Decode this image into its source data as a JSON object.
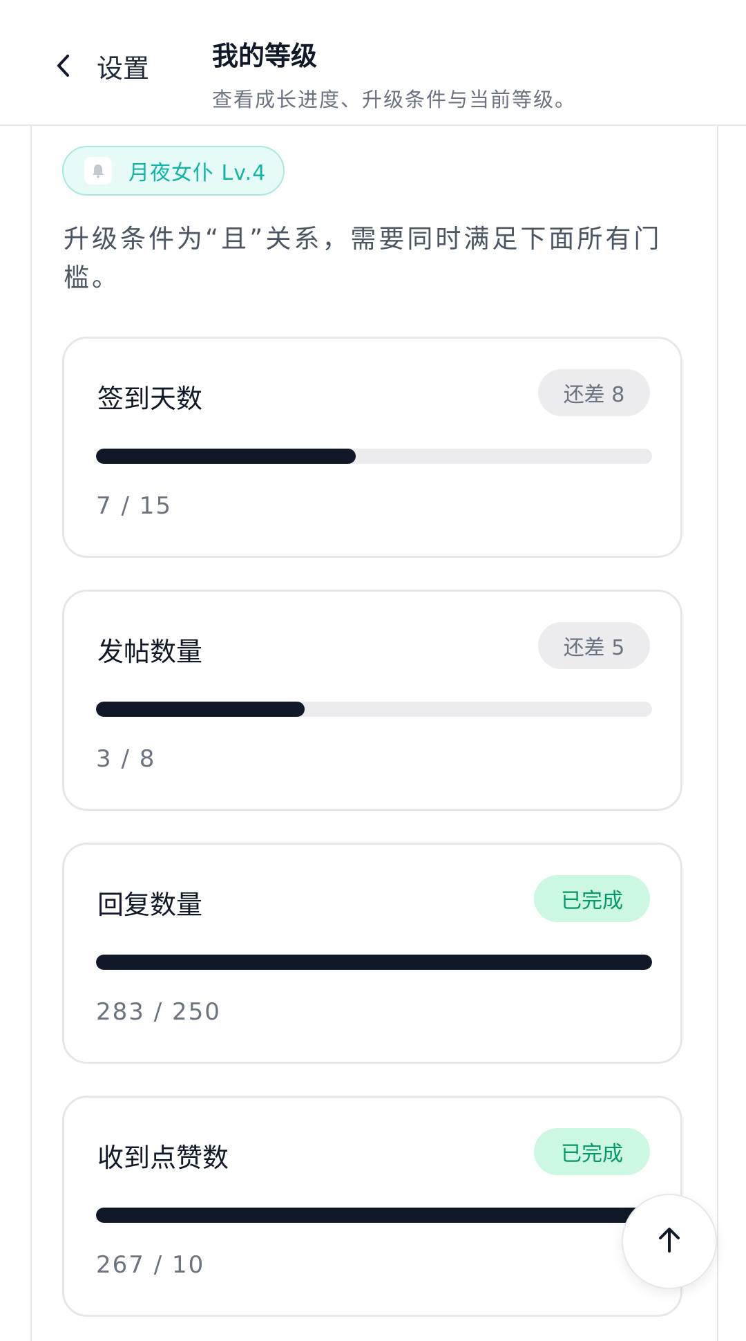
{
  "header": {
    "back_label": "设置",
    "title": "我的等级",
    "subtitle": "查看成长进度、升级条件与当前等级。"
  },
  "badge": {
    "label": "月夜女仆 Lv.4",
    "icon": "bell-icon",
    "accent": "#0fb5a0"
  },
  "description": "升级条件为“且”关系，需要同时满足下面所有门槛。",
  "criteria": [
    {
      "title": "签到天数",
      "status": "还差 8",
      "state": "pending",
      "progress": 0.467,
      "count": "7 / 15"
    },
    {
      "title": "发帖数量",
      "status": "还差 5",
      "state": "pending",
      "progress": 0.375,
      "count": "3 / 8"
    },
    {
      "title": "回复数量",
      "status": "已完成",
      "state": "done",
      "progress": 1.0,
      "count": "283 / 250"
    },
    {
      "title": "收到点赞数",
      "status": "已完成",
      "state": "done",
      "progress": 1.0,
      "count": "267 / 10"
    }
  ],
  "colors": {
    "bar_fill": "#111827",
    "track": "#ececee",
    "done_bg": "#ccf7e2",
    "done_text": "#059669"
  },
  "scroll_top": {
    "icon": "arrow-up-icon"
  }
}
